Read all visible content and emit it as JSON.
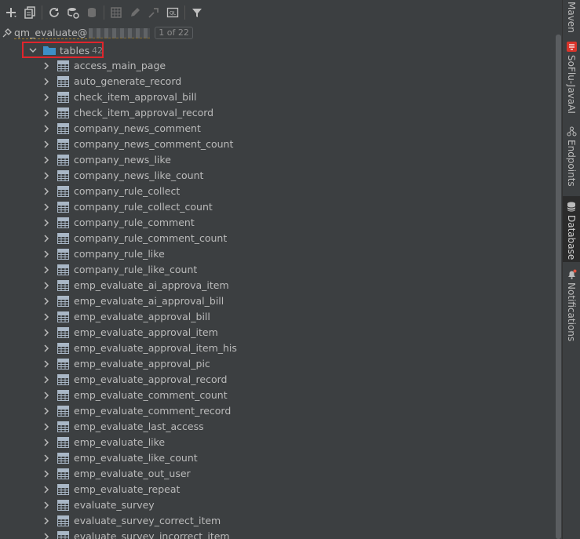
{
  "connection": {
    "name": "qm_evaluate@",
    "counter": "1 of 22"
  },
  "group": {
    "label": "tables",
    "count": "42"
  },
  "tables": [
    "access_main_page",
    "auto_generate_record",
    "check_item_approval_bill",
    "check_item_approval_record",
    "company_news_comment",
    "company_news_comment_count",
    "company_news_like",
    "company_news_like_count",
    "company_rule_collect",
    "company_rule_collect_count",
    "company_rule_comment",
    "company_rule_comment_count",
    "company_rule_like",
    "company_rule_like_count",
    "emp_evaluate_ai_approva_item",
    "emp_evaluate_ai_approval_bill",
    "emp_evaluate_approval_bill",
    "emp_evaluate_approval_item",
    "emp_evaluate_approval_item_his",
    "emp_evaluate_approval_pic",
    "emp_evaluate_approval_record",
    "emp_evaluate_comment_count",
    "emp_evaluate_comment_record",
    "emp_evaluate_last_access",
    "emp_evaluate_like",
    "emp_evaluate_like_count",
    "emp_evaluate_out_user",
    "emp_evaluate_repeat",
    "evaluate_survey",
    "evaluate_survey_correct_item",
    "evaluate_survey_incorrect_item"
  ],
  "toolbar": {
    "sql_icon_text": "QL"
  },
  "sidebar": {
    "maven": "Maven",
    "sofiu": "SoFlu-JavaAI",
    "endpoints": "Endpoints",
    "database": "Database",
    "notifications": "Notifications",
    "sofiu_badge": "飞算"
  },
  "colors": {
    "highlight_border": "#e0252c",
    "background": "#3c3f41",
    "text": "#bbbbbb",
    "folder": "#3d8fc6"
  }
}
